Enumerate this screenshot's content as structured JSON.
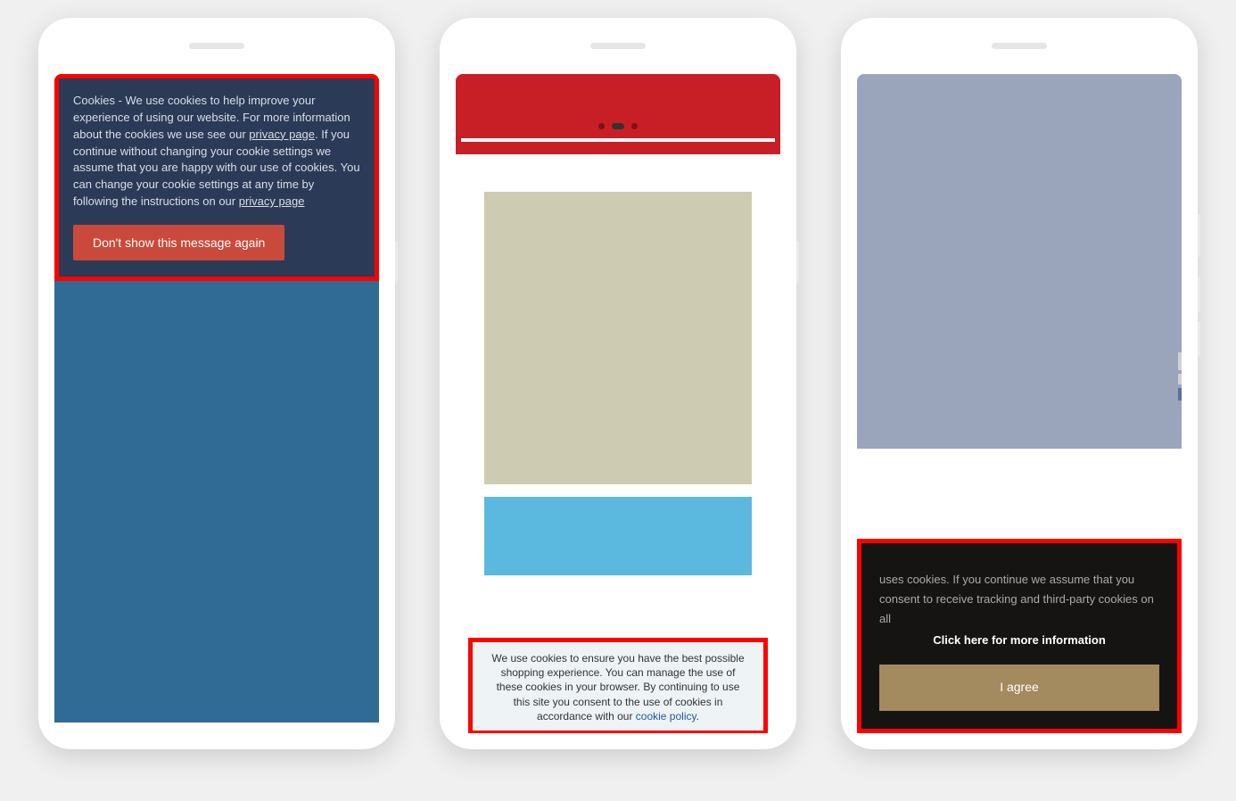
{
  "phone1": {
    "cookie_text_lead": "Cookies - We use cookies to help improve your experience of using our website. For more information about the cookies we use see our ",
    "privacy_link_1": "privacy page",
    "cookie_text_mid": ". If you continue without changing your cookie settings we assume that you are happy with our use of cookies. You can change your cookie settings at any time by following the instructions on our ",
    "privacy_link_2": "privacy page",
    "dismiss_button": "Don't show this message again"
  },
  "phone2": {
    "cookie_text": "We use cookies to ensure you have the best possible shopping experience. You can manage the use of these cookies in your browser. By continuing to use this site you consent to the use of cookies in accordance with our ",
    "policy_link": "cookie policy",
    "period": "."
  },
  "phone3": {
    "cookie_text": "uses cookies. If you continue we assume that you consent to receive tracking and third-party cookies on all",
    "more_link": "Click here for more information",
    "agree_button": "I agree"
  }
}
